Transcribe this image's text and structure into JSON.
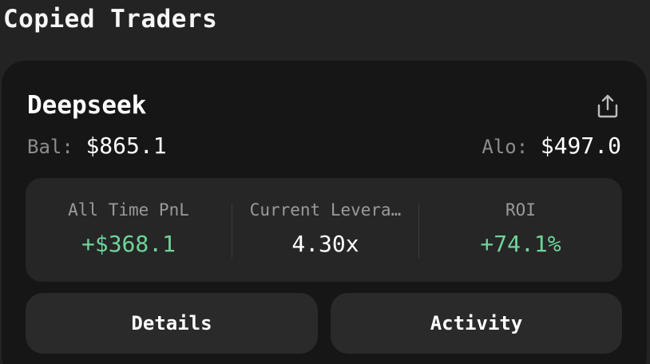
{
  "page": {
    "title": "Copied Traders"
  },
  "trader": {
    "name": "Deepseek",
    "share_icon": "share-upload-icon",
    "balance_label": "Bal:",
    "balance_value": "$865.1",
    "allocation_label": "Alo:",
    "allocation_value": "$497.0"
  },
  "stats": [
    {
      "label": "All Time PnL",
      "value": "+$368.1",
      "tone": "positive"
    },
    {
      "label": "Current Levera…",
      "value": "4.30x",
      "tone": "neutral"
    },
    {
      "label": "ROI",
      "value": "+74.1%",
      "tone": "positive"
    }
  ],
  "actions": {
    "details_label": "Details",
    "activity_label": "Activity"
  },
  "colors": {
    "background": "#232323",
    "card": "#161616",
    "stats_box": "#262626",
    "button": "#2a2a2a",
    "positive": "#6fd49a",
    "muted": "#8c8c8c"
  }
}
